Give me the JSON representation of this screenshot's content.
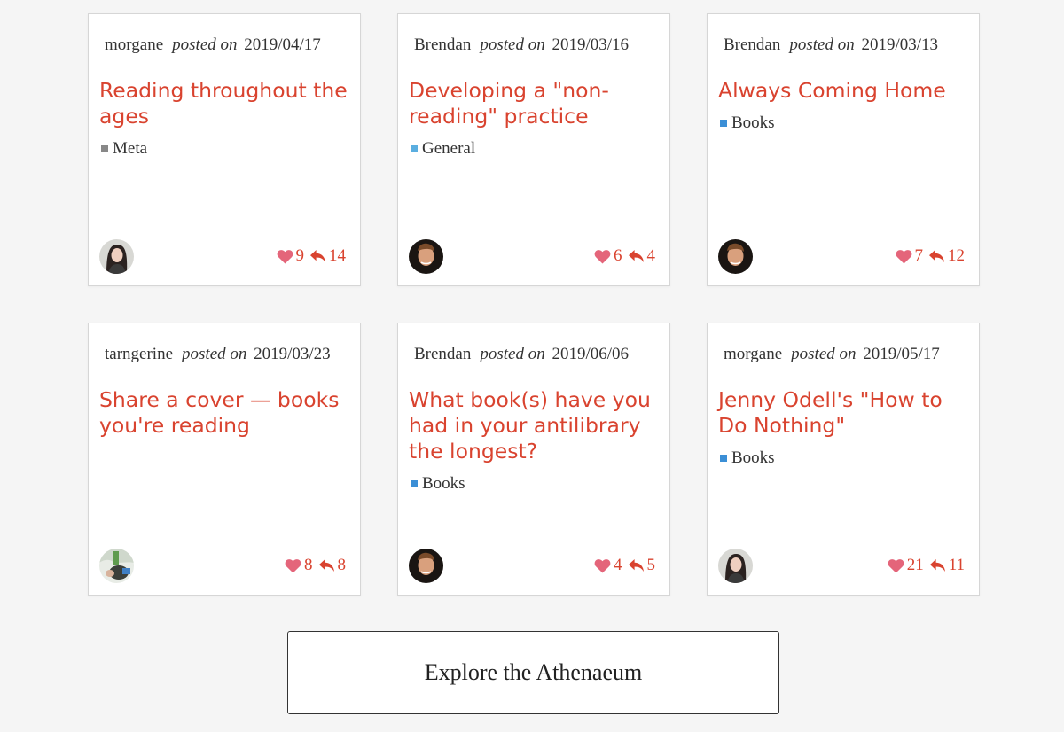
{
  "colors": {
    "accent": "#d9432f",
    "heart": "#e4657a",
    "category_meta": "#888888",
    "category_general": "#5aaee0",
    "category_books": "#3b8fd6"
  },
  "labels": {
    "posted_on": "posted on"
  },
  "topics": [
    {
      "author": "morgane",
      "date": "2019/04/17",
      "title": "Reading throughout the ages",
      "category": "Meta",
      "likes": "9",
      "replies": "14"
    },
    {
      "author": "Brendan",
      "date": "2019/03/16",
      "title": "Developing a \"non-reading\" practice",
      "category": "General",
      "likes": "6",
      "replies": "4"
    },
    {
      "author": "Brendan",
      "date": "2019/03/13",
      "title": "Always Coming Home",
      "category": "Books",
      "likes": "7",
      "replies": "12"
    },
    {
      "author": "tarngerine",
      "date": "2019/03/23",
      "title": "Share a cover — books you're reading",
      "category": "",
      "likes": "8",
      "replies": "8"
    },
    {
      "author": "Brendan",
      "date": "2019/06/06",
      "title": "What book(s) have you had in your antilibrary the longest?",
      "category": "Books",
      "likes": "4",
      "replies": "5"
    },
    {
      "author": "morgane",
      "date": "2019/05/17",
      "title": "Jenny Odell's \"How to Do Nothing\"",
      "category": "Books",
      "likes": "21",
      "replies": "11"
    }
  ],
  "explore_button": {
    "label": "Explore the Athenaeum"
  }
}
